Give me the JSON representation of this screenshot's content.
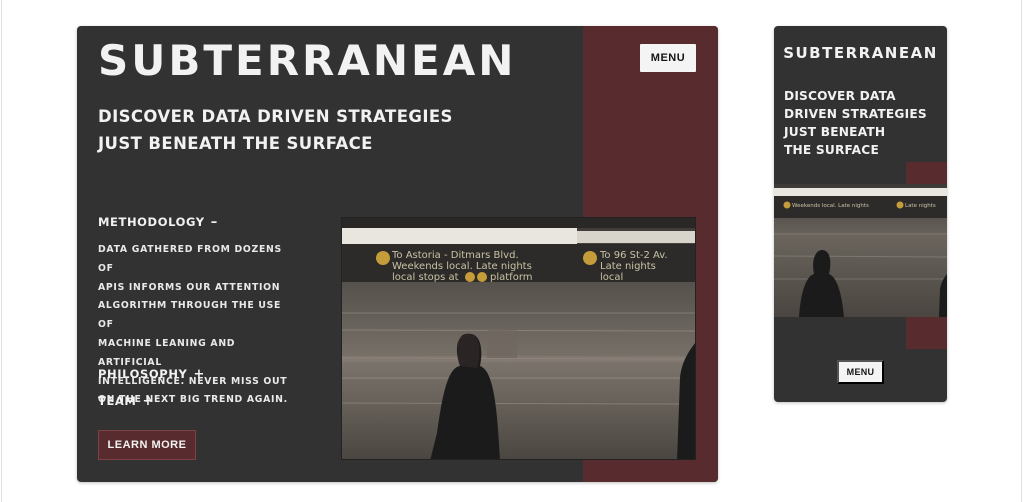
{
  "brand": "SUBTERRANEAN",
  "menu_label": "MENU",
  "tagline_lines": [
    "DISCOVER DATA DRIVEN STRATEGIES",
    "JUST BENEATH THE SURFACE"
  ],
  "mobile_tagline_lines": [
    "DISCOVER DATA",
    "DRIVEN STRATEGIES",
    "JUST BENEATH",
    "THE SURFACE"
  ],
  "sections": [
    {
      "title": "METHODOLOGY",
      "sign": "–",
      "expanded": true
    },
    {
      "title": "PHILOSOPHY",
      "sign": "+",
      "expanded": false
    },
    {
      "title": "TEAM",
      "sign": "+",
      "expanded": false
    }
  ],
  "methodology_lines": [
    "DATA GATHERED FROM DOZENS OF",
    "APIS INFORMS OUR ATTENTION",
    "ALGORITHM THROUGH THE USE OF",
    "MACHINE LEANING AND ARTIFICIAL",
    "INTELLIGENCE. NEVER MISS OUT",
    "ON THE NEXT BIG TREND AGAIN."
  ],
  "learn_more_label": "LEARN MORE",
  "photo_sign": {
    "left_line1": "To Astoria - Ditmars Blvd.",
    "left_line2": "Weekends local. Late nights",
    "left_line3": "local stops at",
    "left_line3_end": "platform",
    "right_line1": "To 96 St-2 Av.",
    "right_line2": "Late nights",
    "right_line3": "local"
  },
  "colors": {
    "card_bg": "#333233",
    "accent": "#582c2e",
    "text": "#f2f2f2",
    "button_bg": "#f4f4f4"
  }
}
